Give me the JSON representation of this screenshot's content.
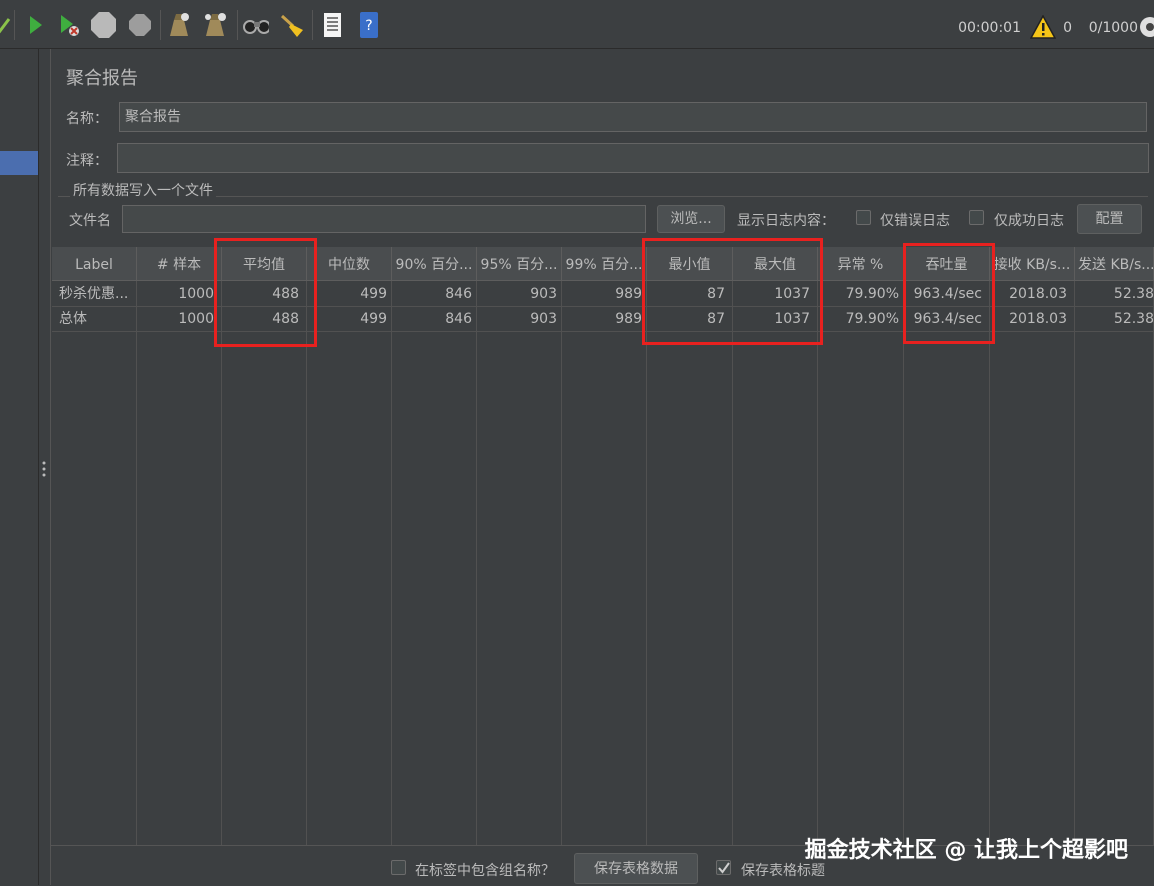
{
  "toolbar": {
    "elapsed": "00:00:01",
    "warning_count": "0",
    "threads": "0/1000"
  },
  "form": {
    "title": "聚合报告",
    "name_label": "名称：",
    "name_value": "聚合报告",
    "comment_label": "注释：",
    "comment_value": "",
    "file_group_label": "所有数据写入一个文件",
    "filename_label": "文件名",
    "filename_value": "",
    "browse_button": "浏览...",
    "log_content_label": "显示日志内容：",
    "errors_only_label": "仅错误日志",
    "success_only_label": "仅成功日志",
    "configure_button": "配置"
  },
  "table": {
    "headers": [
      "Label",
      "# 样本",
      "平均值",
      "中位数",
      "90% 百分...",
      "95% 百分...",
      "99% 百分...",
      "最小值",
      "最大值",
      "异常 %",
      "吞吐量",
      "接收 KB/s...",
      "发送 KB/s..."
    ],
    "rows": [
      [
        "秒杀优惠...",
        "1000",
        "488",
        "499",
        "846",
        "903",
        "989",
        "87",
        "1037",
        "79.90%",
        "963.4/sec",
        "2018.03",
        "52.38"
      ],
      [
        "总体",
        "1000",
        "488",
        "499",
        "846",
        "903",
        "989",
        "87",
        "1037",
        "79.90%",
        "963.4/sec",
        "2018.03",
        "52.38"
      ]
    ]
  },
  "bottom": {
    "include_group_label": "在标签中包含组名称？",
    "save_table_button": "保存表格数据",
    "save_header_label": "保存表格标题"
  },
  "watermark": "掘金技术社区 @ 让我上个超影吧",
  "colors": {
    "background": "#3c3f41",
    "highlight": "#e8211f",
    "selection": "#4b6eaf"
  }
}
